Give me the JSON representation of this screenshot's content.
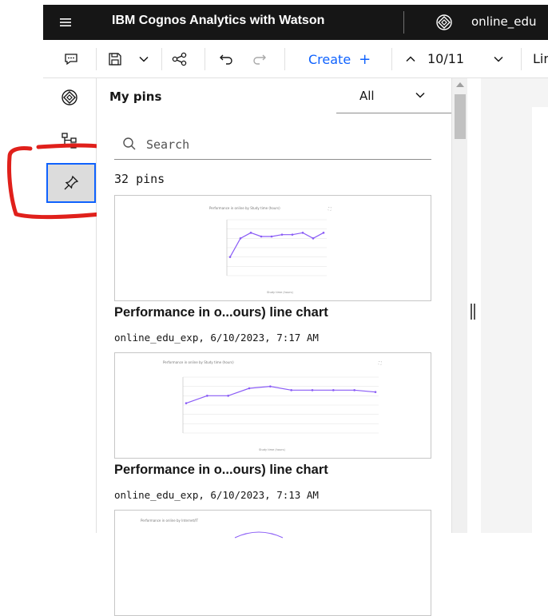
{
  "topbar": {
    "hamburger_icon": "menu-icon",
    "title": "IBM Cognos Analytics with Watson",
    "datasource_icon": "data-module-icon",
    "datasource_name": "online_edu"
  },
  "toolbar": {
    "icons": [
      "comment-icon",
      "save-icon",
      "chevron-down-icon",
      "share-icon",
      "undo-icon",
      "redo-icon"
    ],
    "create_label": "Create",
    "create_plus": "+",
    "counter": "10/11",
    "overflow_label": "Lin"
  },
  "rail": {
    "items": [
      "data-module-icon",
      "hierarchy-icon",
      "pin-icon"
    ],
    "active": "pin-icon"
  },
  "panel": {
    "title": "My pins",
    "filter_value": "All",
    "search_placeholder": "Search",
    "pin_count": "32 pins",
    "pins": [
      {
        "title": "Performance in o...ours) line chart",
        "meta": "online_edu_exp, 6/10/2023, 7:17 AM",
        "thumb_values": [
          4.0,
          5.0,
          5.3,
          5.1,
          5.1,
          5.2,
          5.2,
          5.3,
          5.0,
          5.3
        ]
      },
      {
        "title": "Performance in o...ours) line chart",
        "meta": "online_edu_exp, 6/10/2023, 7:13 AM",
        "thumb_values": [
          4.6,
          5.0,
          5.0,
          5.4,
          5.5,
          5.3,
          5.3,
          5.3,
          5.3,
          5.2
        ]
      }
    ]
  },
  "colors": {
    "accent": "#0f62fe",
    "topbar_bg": "#161616",
    "annotation": "#e0201b",
    "line_series": "#8a5cf6"
  }
}
